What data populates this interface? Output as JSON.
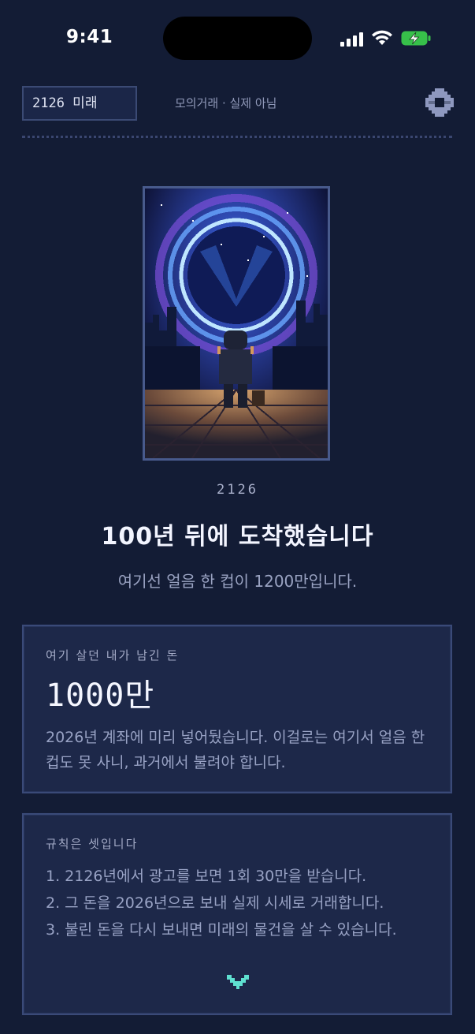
{
  "status_bar": {
    "time": "9:41"
  },
  "header": {
    "future_chip": "2126 미래",
    "mock_label": "모의거래 · 실제 아님",
    "settings_icon": "pixel-gear-icon"
  },
  "hero": {
    "image": "pixel-art-time-portal-traveler",
    "year": "2126",
    "title": "100년 뒤에 도착했습니다",
    "subtitle": "여기선 얼음 한 컵이 1200만입니다."
  },
  "money_card": {
    "label": "여기 살던 내가 남긴 돈",
    "amount": "1000만",
    "description": "2026년 계좌에 미리 넣어뒀습니다. 이걸로는 여기서 얼음 한 컵도 못 사니, 과거에서 불려야 합니다."
  },
  "rules_card": {
    "label": "규칙은 셋입니다",
    "rules": [
      "1. 2126년에서 광고를 보면 1회 30만을 받습니다.",
      "2. 그 돈을 2026년으로 보내 실제 시세로 거래합니다.",
      "3. 불린 돈을 다시 보내면 미래의 물건을 살 수 있습니다."
    ]
  },
  "colors": {
    "background": "#131c35",
    "card": "#1d2849",
    "accent": "#5fe0d0"
  }
}
